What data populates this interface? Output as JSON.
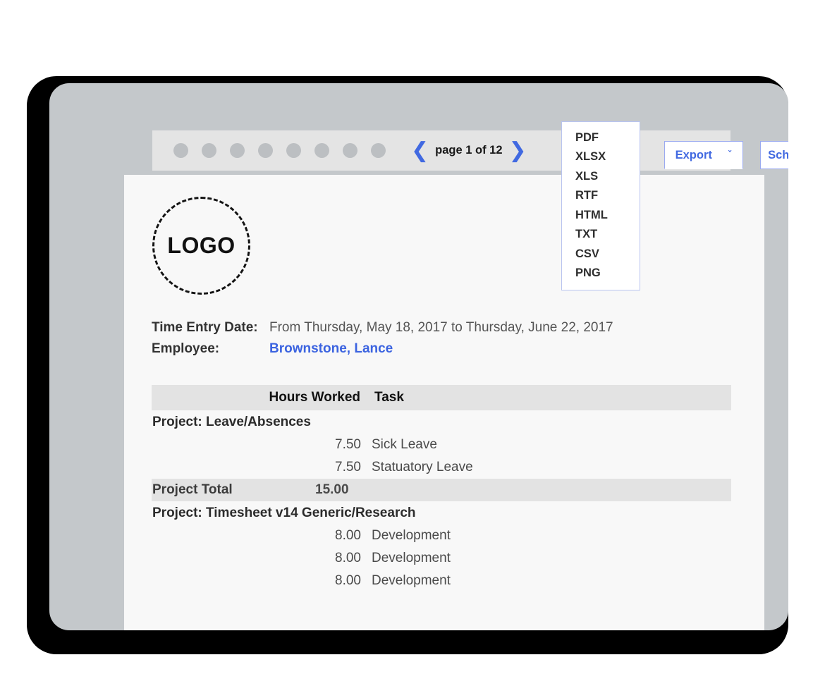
{
  "toolbar": {
    "dots_count": 8,
    "pager": {
      "prev_icon": "chevron-left-icon",
      "label": "page 1 of 12",
      "next_icon": "chevron-right-icon"
    },
    "export_button": {
      "label": "Export",
      "caret": "ˇ"
    },
    "schedule_button": {
      "label": "Schedule",
      "caret": "ˇ"
    }
  },
  "export_menu": {
    "items": [
      "PDF",
      "XLSX",
      "XLS",
      "RTF",
      "HTML",
      "TXT",
      "CSV",
      "PNG"
    ]
  },
  "document": {
    "logo_text": "LOGO",
    "meta": [
      {
        "label": "Time Entry Date:",
        "value": "From Thursday, May 18, 2017 to Thursday, June 22, 2017",
        "is_link": false
      },
      {
        "label": "Employee:",
        "value": "Brownstone, Lance",
        "is_link": true
      }
    ],
    "table": {
      "headers": {
        "hours": "Hours Worked",
        "task": "Task"
      },
      "rows": [
        {
          "type": "group",
          "label": "Project: Leave/Absences"
        },
        {
          "type": "entry",
          "hours": "7.50",
          "task": "Sick Leave"
        },
        {
          "type": "entry",
          "hours": "7.50",
          "task": "Statuatory Leave"
        },
        {
          "type": "total",
          "label": "Project Total",
          "hours": "15.00"
        },
        {
          "type": "group",
          "label": "Project: Timesheet v14 Generic/Research"
        },
        {
          "type": "entry",
          "hours": "8.00",
          "task": "Development"
        },
        {
          "type": "entry",
          "hours": "8.00",
          "task": "Development"
        },
        {
          "type": "entry",
          "hours": "8.00",
          "task": "Development"
        }
      ]
    }
  },
  "colors": {
    "accent_blue": "#4169e1",
    "link_blue": "#3b63e0",
    "toolbar_bg": "#e4e4e4",
    "device_bezel": "#c4c8cb",
    "page_bg": "#f8f8f8",
    "row_shade": "#e3e3e3"
  }
}
